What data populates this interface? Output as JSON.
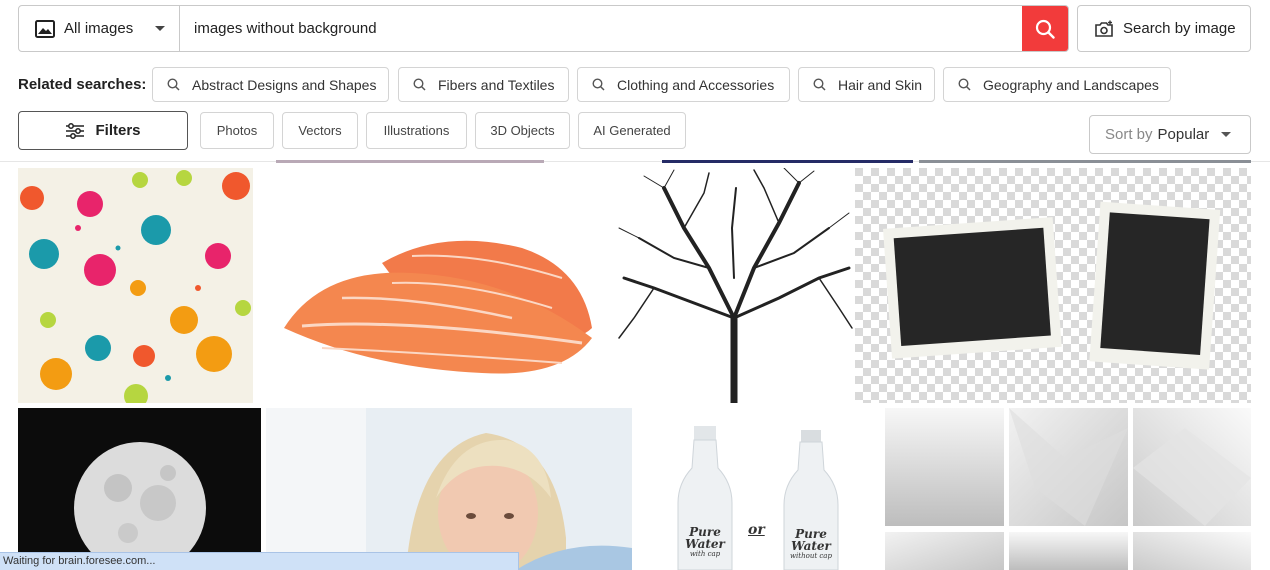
{
  "search": {
    "type_label": "All images",
    "query": "images without background",
    "image_search_label": "Search by image"
  },
  "related": {
    "label": "Related searches:",
    "items": [
      {
        "label": "Abstract Designs and Shapes"
      },
      {
        "label": "Fibers and Textiles"
      },
      {
        "label": "Clothing and Accessories"
      },
      {
        "label": "Hair and Skin"
      },
      {
        "label": "Geography and Landscapes"
      }
    ]
  },
  "filters": {
    "label": "Filters",
    "tags": [
      "Photos",
      "Vectors",
      "Illustrations",
      "3D Objects",
      "AI Generated"
    ],
    "sort_prefix": "Sort by",
    "sort_value": "Popular"
  },
  "results": {
    "bottle_text_1": "Pure",
    "bottle_text_2": "Water",
    "bottle_text_3": "with cap",
    "bottle_text_4": "without cap",
    "bottle_or": "or"
  },
  "status_bar": "Waiting for brain.foresee.com...",
  "colors": {
    "accent": "#f23b3b",
    "status_bg": "#cfe1f7"
  }
}
